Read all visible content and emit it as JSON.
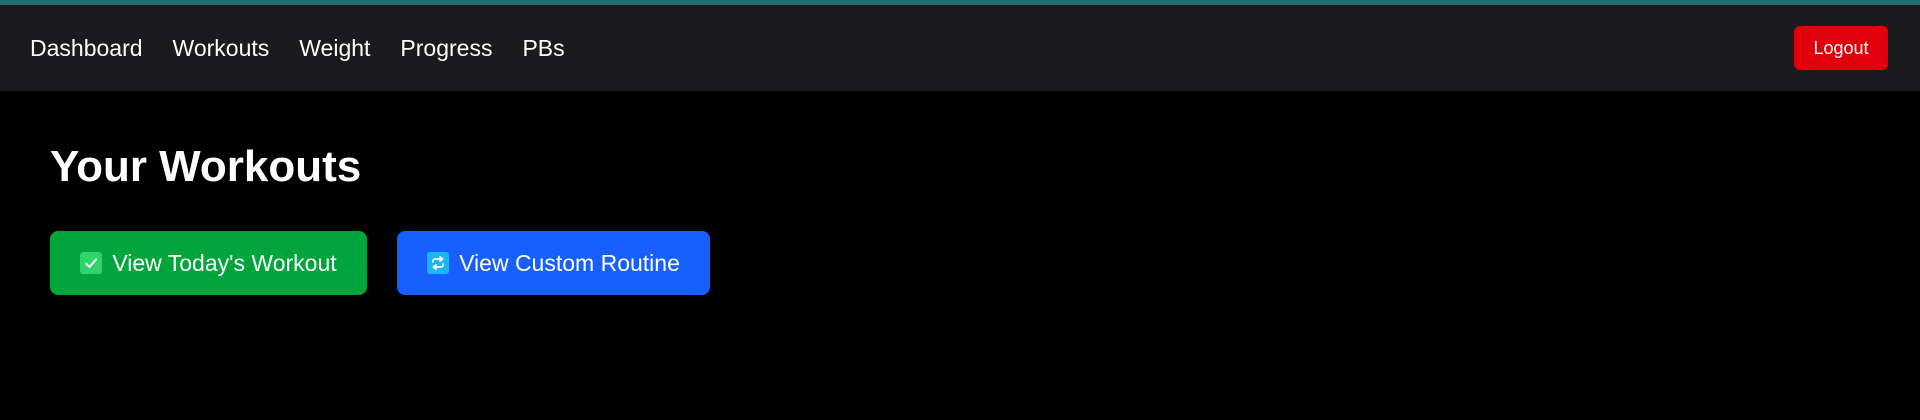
{
  "nav": {
    "links": [
      "Dashboard",
      "Workouts",
      "Weight",
      "Progress",
      "PBs"
    ],
    "logout_label": "Logout"
  },
  "main": {
    "title": "Your Workouts",
    "buttons": {
      "today_label": "View Today's Workout",
      "today_icon": "check-icon",
      "custom_label": "View Custom Routine",
      "custom_icon": "repeat-icon"
    }
  },
  "colors": {
    "accent_bar": "#1f6e73",
    "navbar_bg": "#1b1b1d",
    "logout": "#e0000b",
    "today_button": "#00a63c",
    "custom_button": "#1760ff"
  }
}
